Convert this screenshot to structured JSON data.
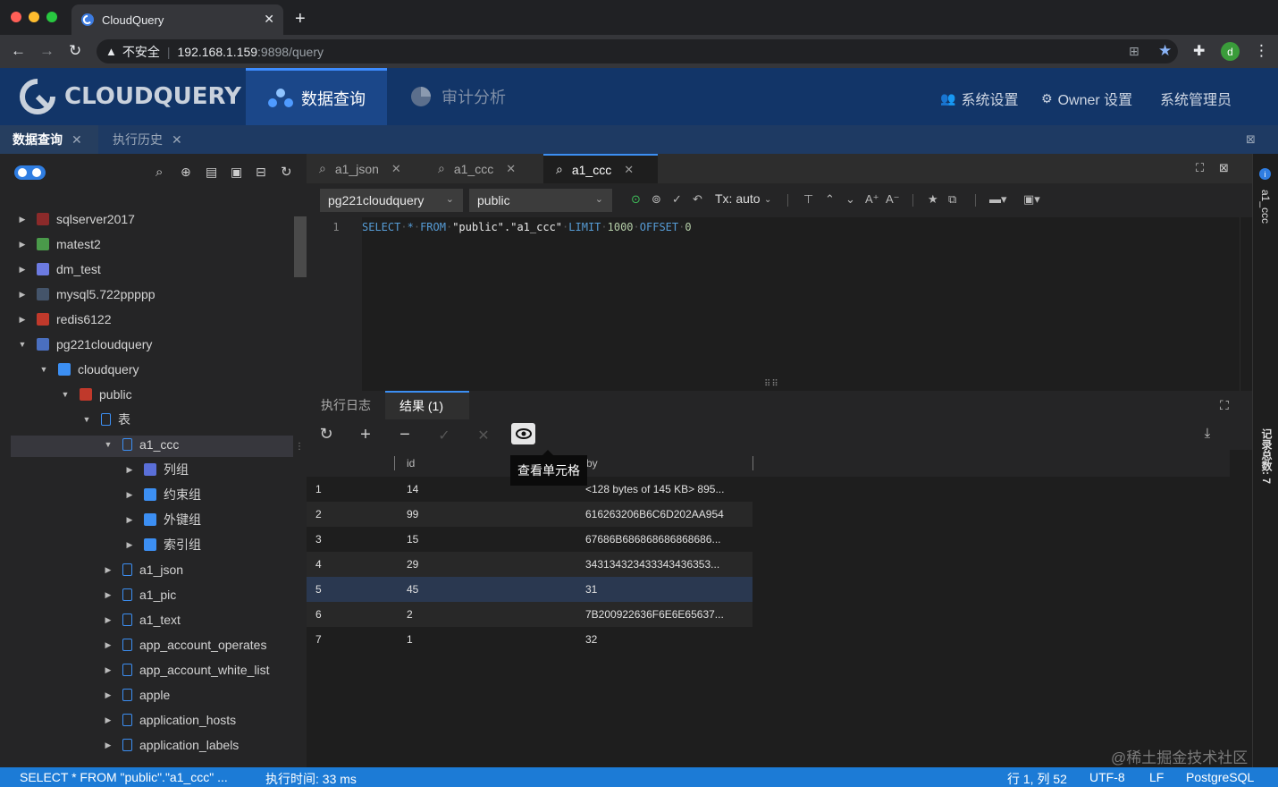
{
  "browser": {
    "tab_title": "CloudQuery",
    "tab_close": "✕",
    "new_tab": "+",
    "insecure_label": "不安全",
    "url_host": "192.168.1.159",
    "url_rest": ":9898/query",
    "profile_initial": "d"
  },
  "header": {
    "logo_text": "CLOUDQUERY",
    "nav": [
      {
        "label": "数据查询",
        "active": true
      },
      {
        "label": "审计分析",
        "active": false
      }
    ],
    "right": {
      "settings": "系统设置",
      "owner_settings": "Owner 设置",
      "admin": "系统管理员"
    }
  },
  "app_tabs": [
    {
      "label": "数据查询",
      "active": true
    },
    {
      "label": "执行历史",
      "active": false
    }
  ],
  "sidebar": {
    "tree": [
      {
        "label": "sqlserver2017",
        "level": 0,
        "expanded": false,
        "icon": "sqlserver-icon"
      },
      {
        "label": "matest2",
        "level": 0,
        "expanded": false,
        "icon": "mongodb-icon"
      },
      {
        "label": "dm_test",
        "level": 0,
        "expanded": false,
        "icon": "dm-icon"
      },
      {
        "label": "mysql5.722ppppp",
        "level": 0,
        "expanded": false,
        "icon": "mysql-icon"
      },
      {
        "label": "redis6122",
        "level": 0,
        "expanded": false,
        "icon": "redis-icon"
      },
      {
        "label": "pg221cloudquery",
        "level": 0,
        "expanded": true,
        "icon": "postgres-icon"
      },
      {
        "label": "cloudquery",
        "level": 1,
        "expanded": true,
        "icon": "database-icon"
      },
      {
        "label": "public",
        "level": 2,
        "expanded": true,
        "icon": "schema-icon"
      },
      {
        "label": "表",
        "level": 3,
        "expanded": true,
        "icon": "tables-icon"
      },
      {
        "label": "a1_ccc",
        "level": 4,
        "expanded": true,
        "icon": "table-icon",
        "selected": true
      },
      {
        "label": "列组",
        "level": 5,
        "expanded": false,
        "icon": "columns-icon"
      },
      {
        "label": "约束组",
        "level": 5,
        "expanded": false,
        "icon": "constraints-icon"
      },
      {
        "label": "外键组",
        "level": 5,
        "expanded": false,
        "icon": "foreign-keys-icon"
      },
      {
        "label": "索引组",
        "level": 5,
        "expanded": false,
        "icon": "indexes-icon"
      },
      {
        "label": "a1_json",
        "level": 4,
        "expanded": false,
        "icon": "table-icon"
      },
      {
        "label": "a1_pic",
        "level": 4,
        "expanded": false,
        "icon": "table-icon"
      },
      {
        "label": "a1_text",
        "level": 4,
        "expanded": false,
        "icon": "table-icon"
      },
      {
        "label": "app_account_operates",
        "level": 4,
        "expanded": false,
        "icon": "table-icon"
      },
      {
        "label": "app_account_white_list",
        "level": 4,
        "expanded": false,
        "icon": "table-icon"
      },
      {
        "label": "apple",
        "level": 4,
        "expanded": false,
        "icon": "table-icon"
      },
      {
        "label": "application_hosts",
        "level": 4,
        "expanded": false,
        "icon": "table-icon"
      },
      {
        "label": "application_labels",
        "level": 4,
        "expanded": false,
        "icon": "table-icon"
      }
    ]
  },
  "editor": {
    "tabs": [
      {
        "label": "a1_json",
        "active": false
      },
      {
        "label": "a1_ccc",
        "active": false
      },
      {
        "label": "a1_ccc",
        "active": true
      }
    ],
    "connection": "pg221cloudquery",
    "schema": "public",
    "tx_mode": "Tx: auto",
    "line_number": "1",
    "sql": {
      "kw1": "SELECT",
      "star": "*",
      "kw2": "FROM",
      "table": "\"public\".\"a1_ccc\"",
      "kw3": "LIMIT",
      "limit": "1000",
      "kw4": "OFFSET",
      "offset": "0"
    }
  },
  "results": {
    "tabs": [
      {
        "label": "执行日志",
        "active": false
      },
      {
        "label": "结果 (1)",
        "active": true
      }
    ],
    "tooltip": "查看单元格",
    "columns": [
      "id",
      "by"
    ],
    "rows": [
      {
        "n": "1",
        "id": "14",
        "by": "<128 bytes of 145 KB> 895..."
      },
      {
        "n": "2",
        "id": "99",
        "by": "616263206B6C6D202AA954"
      },
      {
        "n": "3",
        "id": "15",
        "by": "67686B686868686868686..."
      },
      {
        "n": "4",
        "id": "29",
        "by": "343134323433343436353..."
      },
      {
        "n": "5",
        "id": "45",
        "by": "31"
      },
      {
        "n": "6",
        "id": "2",
        "by": "7B200922636F6E6E65637..."
      },
      {
        "n": "7",
        "id": "1",
        "by": "32"
      }
    ]
  },
  "rail": {
    "top_label": "a1_ccc",
    "record_count": "记录总数: 7"
  },
  "status": {
    "sql": "SELECT * FROM \"public\".\"a1_ccc\" ...",
    "exec_time": "执行时间: 33 ms",
    "position": "行 1, 列 52",
    "encoding": "UTF-8",
    "eol": "LF",
    "dialect": "PostgreSQL"
  },
  "watermark": "@稀土掘金技术社区",
  "colors": {
    "header_bg": "#123568",
    "accent": "#3c8ff3",
    "status_bg": "#1c7bd6"
  }
}
